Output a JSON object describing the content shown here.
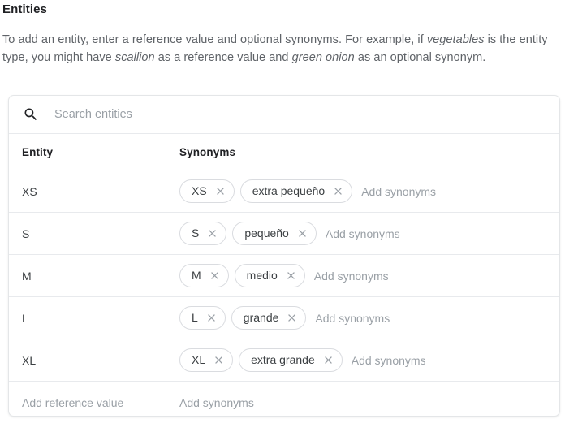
{
  "section": {
    "title": "Entities",
    "description_parts": [
      {
        "text": "To add an entity, enter a reference value and optional synonyms. For example, if ",
        "italic": false
      },
      {
        "text": "vegetables",
        "italic": true
      },
      {
        "text": " is the entity type, you might have ",
        "italic": false
      },
      {
        "text": "scallion",
        "italic": true
      },
      {
        "text": " as a reference value and ",
        "italic": false
      },
      {
        "text": "green onion",
        "italic": true
      },
      {
        "text": " as an optional synonym.",
        "italic": false
      }
    ]
  },
  "search": {
    "icon": "search-icon",
    "placeholder": "Search entities",
    "value": ""
  },
  "table": {
    "columns": [
      {
        "key": "entity",
        "label": "Entity"
      },
      {
        "key": "synonyms",
        "label": "Synonyms"
      }
    ],
    "add_synonyms_placeholder": "Add synonyms",
    "add_reference_placeholder": "Add reference value",
    "remove_icon": "close-icon",
    "rows": [
      {
        "entity": "XS",
        "synonyms": [
          "XS",
          "extra pequeño"
        ]
      },
      {
        "entity": "S",
        "synonyms": [
          "S",
          "pequeño"
        ]
      },
      {
        "entity": "M",
        "synonyms": [
          "M",
          "medio"
        ]
      },
      {
        "entity": "L",
        "synonyms": [
          "L",
          "grande"
        ]
      },
      {
        "entity": "XL",
        "synonyms": [
          "XL",
          "extra grande"
        ]
      }
    ]
  },
  "colors": {
    "background": "#ffffff",
    "text_primary": "#202124",
    "text_secondary": "#5f6368",
    "text_placeholder": "#9aa0a6",
    "border": "#e8eaed",
    "chip_border": "#dadce0",
    "chip_remove": "#9aa0a6"
  }
}
